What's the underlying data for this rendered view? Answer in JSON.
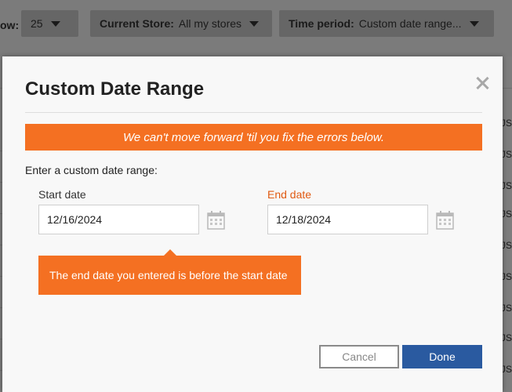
{
  "toolbar": {
    "show_label": "ow:",
    "show_value": "25",
    "store_label": "Current Store:",
    "store_value": "All my stores",
    "period_label": "Time period:",
    "period_value": "Custom date range..."
  },
  "background": {
    "right_cells": [
      "JS",
      "JS",
      "JS",
      "JS",
      "JS",
      "JS",
      "JS",
      "JS",
      "JS"
    ]
  },
  "modal": {
    "title": "Custom Date Range",
    "error_banner": "We can't move forward 'til you fix the errors below.",
    "instruction": "Enter a custom date range:",
    "start_label": "Start date",
    "start_value": "12/16/2024",
    "end_label": "End date",
    "end_value": "12/18/2024",
    "field_error": "The end date you entered is before the start date",
    "cancel_label": "Cancel",
    "done_label": "Done"
  },
  "colors": {
    "error": "#f47022",
    "primary": "#2a5aa0",
    "end_label": "#e05a12"
  },
  "icons": [
    "close-icon",
    "calendar-icon",
    "chevron-down-icon"
  ]
}
